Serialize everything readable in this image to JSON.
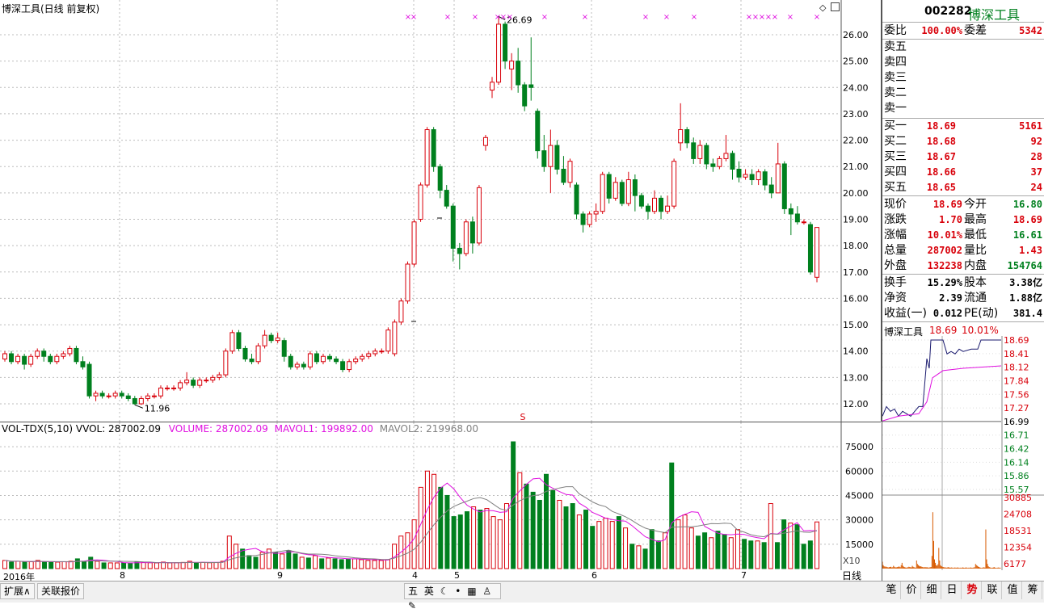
{
  "chart_title": "博深工具(日线 前复权)",
  "kline": {
    "price_ticks": [
      "26.00",
      "25.00",
      "24.00",
      "23.00",
      "22.00",
      "21.00",
      "20.00",
      "19.00",
      "18.00",
      "17.00",
      "16.00",
      "15.00",
      "14.00",
      "13.00",
      "12.00"
    ],
    "high_label": "26.69",
    "low_label": "11.96",
    "markers": "×",
    "s_marker": "S",
    "candles_sample_note": ""
  },
  "volume": {
    "legend_name": "VOL-TDX(5,10)",
    "legend_vvol": "VVOL: 287002.09",
    "legend_volume": "VOLUME: 287002.09",
    "legend_mavol1": "MAVOL1: 199892.00",
    "legend_mavol2": "MAVOL2: 219968.00",
    "ticks": [
      "75000",
      "60000",
      "45000",
      "30000",
      "15000"
    ],
    "unit": "X10"
  },
  "x_axis": {
    "labels": [
      "2016年",
      "8",
      "9",
      "4",
      "5",
      "6",
      "7"
    ]
  },
  "bottom_left": {
    "expand": "扩展∧",
    "related": "关联报价"
  },
  "toolbar_icons": [
    "五",
    "英"
  ],
  "quote": {
    "code": "002282",
    "name": "博深工具",
    "weibi_label": "委比",
    "weibi_val": "100.00%",
    "weicha_label": "委差",
    "weicha_val": "5342",
    "sell": [
      {
        "label": "卖五",
        "price": "",
        "vol": ""
      },
      {
        "label": "卖四",
        "price": "",
        "vol": ""
      },
      {
        "label": "卖三",
        "price": "",
        "vol": ""
      },
      {
        "label": "卖二",
        "price": "",
        "vol": ""
      },
      {
        "label": "卖一",
        "price": "",
        "vol": ""
      }
    ],
    "buy": [
      {
        "label": "买一",
        "price": "18.69",
        "vol": "5161"
      },
      {
        "label": "买二",
        "price": "18.68",
        "vol": "92"
      },
      {
        "label": "买三",
        "price": "18.67",
        "vol": "28"
      },
      {
        "label": "买四",
        "price": "18.66",
        "vol": "37"
      },
      {
        "label": "买五",
        "price": "18.65",
        "vol": "24"
      }
    ],
    "stats": [
      {
        "l1": "现价",
        "v1": "18.69",
        "c1": "red",
        "l2": "今开",
        "v2": "16.80",
        "c2": "green"
      },
      {
        "l1": "涨跌",
        "v1": "1.70",
        "c1": "red",
        "l2": "最高",
        "v2": "18.69",
        "c2": "red"
      },
      {
        "l1": "涨幅",
        "v1": "10.01%",
        "c1": "red",
        "l2": "最低",
        "v2": "16.61",
        "c2": "green"
      },
      {
        "l1": "总量",
        "v1": "287002",
        "c1": "red",
        "l2": "量比",
        "v2": "1.43",
        "c2": "red"
      },
      {
        "l1": "外盘",
        "v1": "132238",
        "c1": "red",
        "l2": "内盘",
        "v2": "154764",
        "c2": "green"
      }
    ],
    "finance": [
      {
        "l1": "换手",
        "v1": "15.29%",
        "l2": "股本",
        "v2": "3.38亿"
      },
      {
        "l1": "净资",
        "v1": "2.39",
        "l2": "流通",
        "v2": "1.88亿"
      },
      {
        "l1": "收益(一)",
        "v1": "0.012",
        "l2": "PE(动)",
        "v2": "381.4"
      }
    ]
  },
  "intraday": {
    "name": "博深工具",
    "price": "18.69",
    "pct": "10.01%",
    "price_ticks": [
      "18.69",
      "18.41",
      "18.12",
      "17.84",
      "17.56",
      "17.27",
      "16.99",
      "16.71",
      "16.42",
      "16.14",
      "15.86",
      "15.57"
    ],
    "vol_ticks": [
      "30885",
      "24708",
      "18531",
      "12354",
      "6177"
    ]
  },
  "daily_tab": "日线",
  "right_tabs": [
    "笔",
    "价",
    "细",
    "日",
    "势",
    "联",
    "值",
    "筹"
  ],
  "colors": {
    "up": "#d8000a",
    "down": "#00801e",
    "ma1": "#e010e0",
    "ma2": "#808080"
  }
}
